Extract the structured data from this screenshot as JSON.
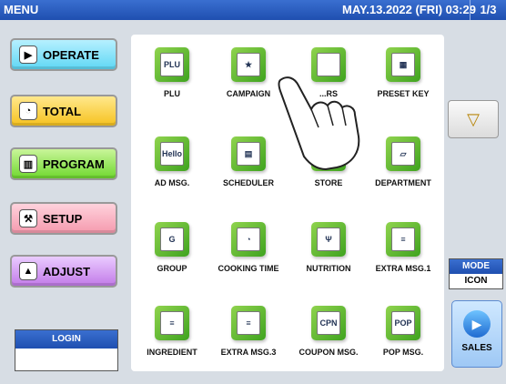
{
  "header": {
    "title": "MENU",
    "datetime": "MAY.13.2022 (FRI)  03:29",
    "page": "1/3"
  },
  "left_menu": [
    {
      "label": "OPERATE",
      "icon": "circle-arrow-icon"
    },
    {
      "label": "TOTAL",
      "icon": "clock-icon"
    },
    {
      "label": "PROGRAM",
      "icon": "book-icon"
    },
    {
      "label": "SETUP",
      "icon": "wrench-icon"
    },
    {
      "label": "ADJUST",
      "icon": "triangle-icon"
    }
  ],
  "login": {
    "label": "LOGIN",
    "value": ""
  },
  "tiles": [
    {
      "label": "PLU",
      "glyph": "PLU"
    },
    {
      "label": "CAMPAIGN",
      "glyph": "★"
    },
    {
      "label": "...RS",
      "glyph": ""
    },
    {
      "label": "PRESET KEY",
      "glyph": "▦"
    },
    {
      "label": "AD MSG.",
      "glyph": "Hello"
    },
    {
      "label": "SCHEDULER",
      "glyph": "▤"
    },
    {
      "label": "STORE",
      "glyph": "S"
    },
    {
      "label": "DEPARTMENT",
      "glyph": "▱"
    },
    {
      "label": "GROUP",
      "glyph": "G"
    },
    {
      "label": "COOKING TIME",
      "glyph": "◔"
    },
    {
      "label": "NUTRITION",
      "glyph": "Ψ"
    },
    {
      "label": "EXTRA MSG.1",
      "glyph": "≡"
    },
    {
      "label": "INGREDIENT",
      "glyph": "≡"
    },
    {
      "label": "EXTRA MSG.3",
      "glyph": "≡"
    },
    {
      "label": "COUPON MSG.",
      "glyph": "CPN"
    },
    {
      "label": "POP MSG.",
      "glyph": "POP"
    }
  ],
  "side": {
    "scroll_arrow": "▽",
    "mode_header": "MODE",
    "mode_value": "ICON",
    "sales_label": "SALES"
  },
  "colors": {
    "header_blue": "#1f4fb0",
    "tile_green": "#3fa31f"
  }
}
